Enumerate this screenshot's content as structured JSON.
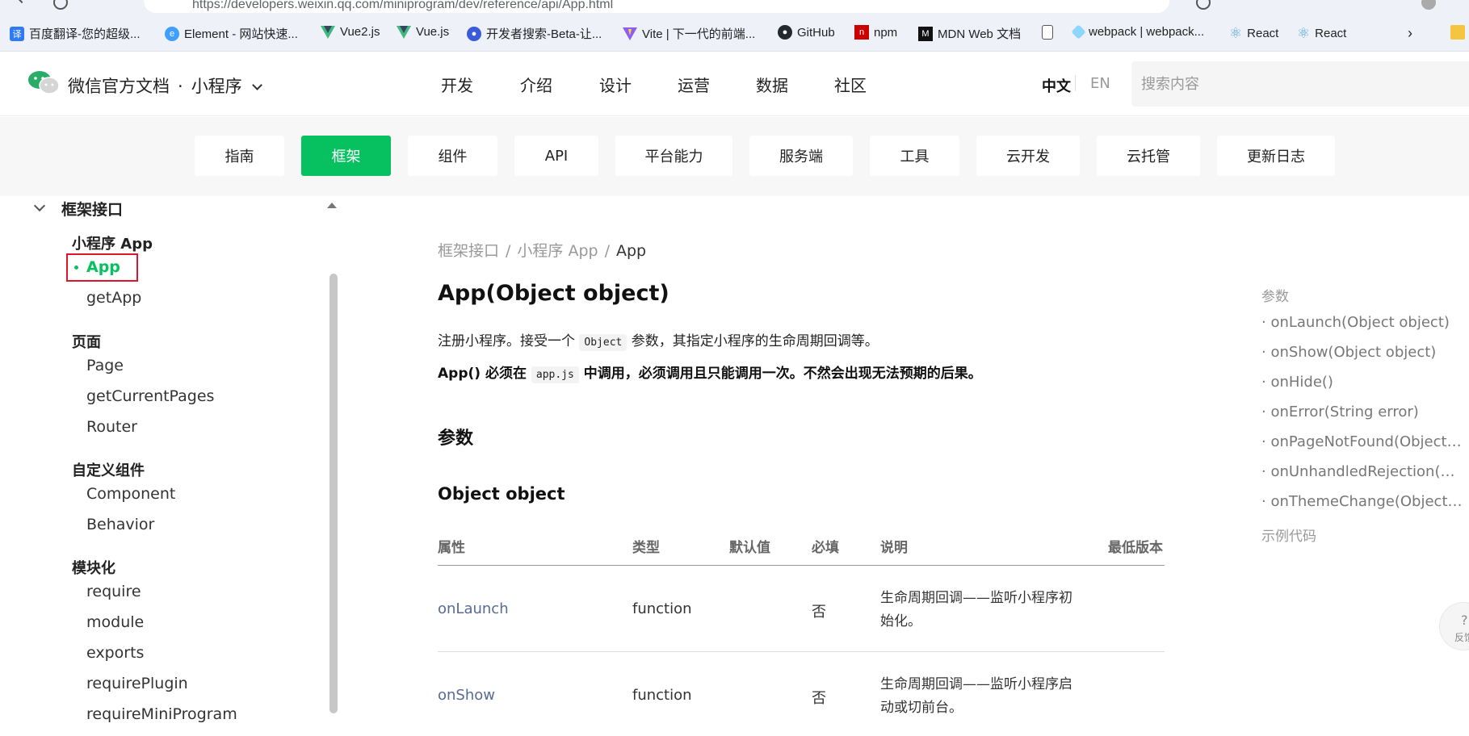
{
  "browser": {
    "url": "https://developers.weixin.qq.com/miniprogram/dev/reference/api/App.html",
    "bookmarks": [
      {
        "label": "百度翻译-您的超级...",
        "icon": "baidu-translate-icon",
        "color": "#2f7bf5"
      },
      {
        "label": "Element - 网站快速...",
        "icon": "element-icon",
        "color": "#409eff"
      },
      {
        "label": "Vue2.js",
        "icon": "vue-icon",
        "color": "#41b883"
      },
      {
        "label": "Vue.js",
        "icon": "vue-icon",
        "color": "#41b883"
      },
      {
        "label": "开发者搜索-Beta-让...",
        "icon": "devsearch-icon",
        "color": "#3b5bdb"
      },
      {
        "label": "Vite | 下一代的前端...",
        "icon": "vite-icon",
        "color": "#8b5cf6"
      },
      {
        "label": "GitHub",
        "icon": "github-icon",
        "color": "#24292f"
      },
      {
        "label": "npm",
        "icon": "npm-icon",
        "color": "#cb0000"
      },
      {
        "label": "MDN Web 文档",
        "icon": "mdn-icon",
        "color": "#111111"
      },
      {
        "label": "",
        "icon": "document-icon",
        "color": "#666666"
      },
      {
        "label": "webpack | webpack...",
        "icon": "webpack-icon",
        "color": "#1c78c0"
      },
      {
        "label": "React",
        "icon": "react-icon",
        "color": "#5fa8d3"
      },
      {
        "label": "React",
        "icon": "react-icon",
        "color": "#5fa8d3"
      }
    ]
  },
  "header": {
    "brand": "微信官方文档",
    "dot": "·",
    "product": "小程序",
    "nav": [
      "开发",
      "介绍",
      "设计",
      "运营",
      "数据",
      "社区"
    ],
    "lang_zh": "中文",
    "lang_en": "EN",
    "search_placeholder": "搜索内容"
  },
  "tabs": [
    "指南",
    "框架",
    "组件",
    "API",
    "平台能力",
    "服务端",
    "工具",
    "云开发",
    "云托管",
    "更新日志"
  ],
  "sidebar": {
    "section": "框架接口",
    "groups": [
      {
        "title": "小程序 App",
        "items": [
          "App",
          "getApp"
        ]
      },
      {
        "title": "页面",
        "items": [
          "Page",
          "getCurrentPages",
          "Router"
        ]
      },
      {
        "title": "自定义组件",
        "items": [
          "Component",
          "Behavior"
        ]
      },
      {
        "title": "模块化",
        "items": [
          "require",
          "module",
          "exports",
          "requirePlugin",
          "requireMiniProgram"
        ]
      }
    ]
  },
  "content": {
    "breadcrumb": [
      "框架接口",
      "小程序 App",
      "App"
    ],
    "breadcrumb_sep": "/",
    "title": "App(Object object)",
    "intro_a": "注册小程序。接受一个",
    "intro_code": "Object",
    "intro_b": "参数，其指定小程序的生命周期回调等。",
    "warn_a": "App() 必须在",
    "warn_code": "app.js",
    "warn_b": "中调用，必须调用且只能调用一次。不然会出现无法预期的后果。",
    "h2": "参数",
    "h3": "Object object",
    "table": {
      "headers": [
        "属性",
        "类型",
        "默认值",
        "必填",
        "说明",
        "最低版本"
      ],
      "rows": [
        {
          "name": "onLaunch",
          "type": "function",
          "default": "",
          "required": "否",
          "desc": "生命周期回调——监听小程序初始化。"
        },
        {
          "name": "onShow",
          "type": "function",
          "default": "",
          "required": "否",
          "desc": "生命周期回调——监听小程序启动或切前台。"
        }
      ]
    }
  },
  "toc": {
    "title": "参数",
    "items": [
      "· onLaunch(Object object)",
      "· onShow(Object object)",
      "· onHide()",
      "· onError(String error)",
      "· onPageNotFound(Object ...",
      "· onUnhandledRejection(O...",
      "· onThemeChange(Object o..."
    ],
    "example": "示例代码"
  },
  "feedback": {
    "icon": "question-icon",
    "label": "反馈"
  },
  "colors": {
    "accent": "#07c160",
    "link": "#576b95",
    "highlight_box": "#e0142b"
  }
}
